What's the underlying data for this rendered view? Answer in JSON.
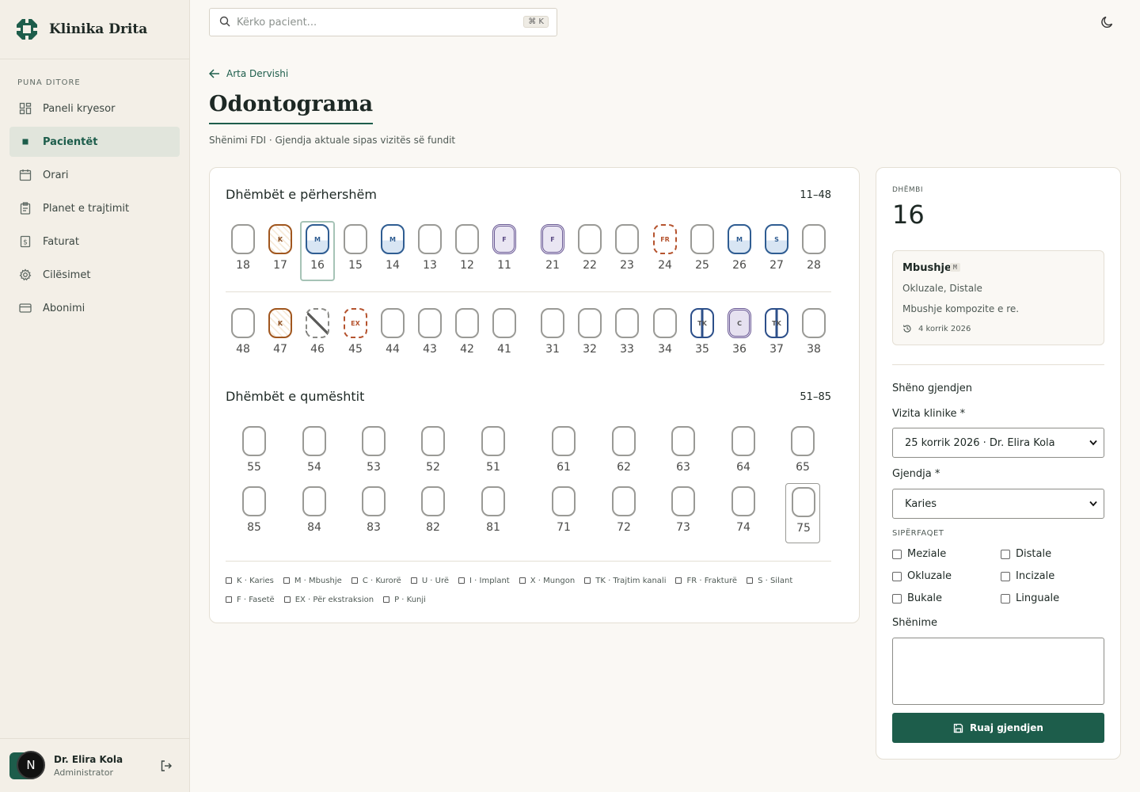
{
  "brand": {
    "name": "Klinika Drita"
  },
  "sidebar": {
    "section_label": "PUNA DITORE",
    "items": [
      {
        "label": "Paneli kryesor",
        "icon": "dashboard-icon"
      },
      {
        "label": "Pacientët",
        "icon": "dot-icon",
        "active": true
      },
      {
        "label": "Orari",
        "icon": "calendar-icon"
      },
      {
        "label": "Planet e trajtimit",
        "icon": "clipboard-icon"
      },
      {
        "label": "Faturat",
        "icon": "invoice-icon"
      },
      {
        "label": "Cilësimet",
        "icon": "gear-icon"
      },
      {
        "label": "Abonimi",
        "icon": "card-icon"
      }
    ]
  },
  "user": {
    "name": "Dr. Elira Kola",
    "role": "Administrator",
    "avatar_letter": "N"
  },
  "search": {
    "placeholder": "Kërko pacient...",
    "shortcut": "⌘ K"
  },
  "page": {
    "back_label": "Arta Dervishi",
    "title": "Odontograma",
    "subtitle": "Shënimi FDI · Gjendja aktuale sipas vizitës së fundit"
  },
  "permanent": {
    "title": "Dhëmbët e përhershëm",
    "range": "11–48",
    "upper": [
      {
        "n": "18",
        "s": ""
      },
      {
        "n": "17",
        "s": "K"
      },
      {
        "n": "16",
        "s": "M",
        "selected": true
      },
      {
        "n": "15",
        "s": ""
      },
      {
        "n": "14",
        "s": "M"
      },
      {
        "n": "13",
        "s": ""
      },
      {
        "n": "12",
        "s": ""
      },
      {
        "n": "11",
        "s": "F"
      },
      {
        "n": "21",
        "s": "F"
      },
      {
        "n": "22",
        "s": ""
      },
      {
        "n": "23",
        "s": ""
      },
      {
        "n": "24",
        "s": "FR"
      },
      {
        "n": "25",
        "s": ""
      },
      {
        "n": "26",
        "s": "M"
      },
      {
        "n": "27",
        "s": "S"
      },
      {
        "n": "28",
        "s": ""
      }
    ],
    "lower": [
      {
        "n": "48",
        "s": ""
      },
      {
        "n": "47",
        "s": "K"
      },
      {
        "n": "46",
        "s": "X"
      },
      {
        "n": "45",
        "s": "EX"
      },
      {
        "n": "44",
        "s": ""
      },
      {
        "n": "43",
        "s": ""
      },
      {
        "n": "42",
        "s": ""
      },
      {
        "n": "41",
        "s": ""
      },
      {
        "n": "31",
        "s": ""
      },
      {
        "n": "32",
        "s": ""
      },
      {
        "n": "33",
        "s": ""
      },
      {
        "n": "34",
        "s": ""
      },
      {
        "n": "35",
        "s": "TK"
      },
      {
        "n": "36",
        "s": "C"
      },
      {
        "n": "37",
        "s": "TK"
      },
      {
        "n": "38",
        "s": ""
      }
    ]
  },
  "primary": {
    "title": "Dhëmbët e qumështit",
    "range": "51–85",
    "upper": [
      {
        "n": "55",
        "s": ""
      },
      {
        "n": "54",
        "s": ""
      },
      {
        "n": "53",
        "s": ""
      },
      {
        "n": "52",
        "s": ""
      },
      {
        "n": "51",
        "s": ""
      },
      {
        "n": "61",
        "s": ""
      },
      {
        "n": "62",
        "s": ""
      },
      {
        "n": "63",
        "s": ""
      },
      {
        "n": "64",
        "s": ""
      },
      {
        "n": "65",
        "s": ""
      }
    ],
    "lower": [
      {
        "n": "85",
        "s": ""
      },
      {
        "n": "84",
        "s": ""
      },
      {
        "n": "83",
        "s": ""
      },
      {
        "n": "82",
        "s": ""
      },
      {
        "n": "81",
        "s": ""
      },
      {
        "n": "71",
        "s": ""
      },
      {
        "n": "72",
        "s": ""
      },
      {
        "n": "73",
        "s": ""
      },
      {
        "n": "74",
        "s": ""
      },
      {
        "n": "75",
        "s": "",
        "boxed": true
      }
    ]
  },
  "legend": [
    "K · Karies",
    "M · Mbushje",
    "C · Kurorë",
    "U · Urë",
    "I · Implant",
    "X · Mungon",
    "TK · Trajtim kanali",
    "FR · Frakturë",
    "S · Silant",
    "F · Fasetë",
    "EX · Për ekstraksion",
    "P · Kunji"
  ],
  "panel": {
    "label": "DHËMBI",
    "tooth": "16",
    "record": {
      "title": "Mbushje",
      "code": "M",
      "surfaces": "Okluzale, Distale",
      "note": "Mbushje kompozite e re.",
      "date": "4 korrik 2026"
    },
    "form_heading": "Shëno gjendjen",
    "visit_label": "Vizita klinike *",
    "visit_value": "25 korrik 2026 · Dr. Elira Kola",
    "state_label": "Gjendja *",
    "state_value": "Karies",
    "surfaces_caption": "SIPËRFAQET",
    "surfaces": [
      "Meziale",
      "Distale",
      "Okluzale",
      "Incizale",
      "Bukale",
      "Linguale"
    ],
    "notes_label": "Shënime",
    "save_label": "Ruaj gjendjen"
  },
  "colors": {
    "accent": "#1d5d4b",
    "caries": "#a0561e",
    "filling": "#2f5d92",
    "veneer": "#6b5b95"
  }
}
